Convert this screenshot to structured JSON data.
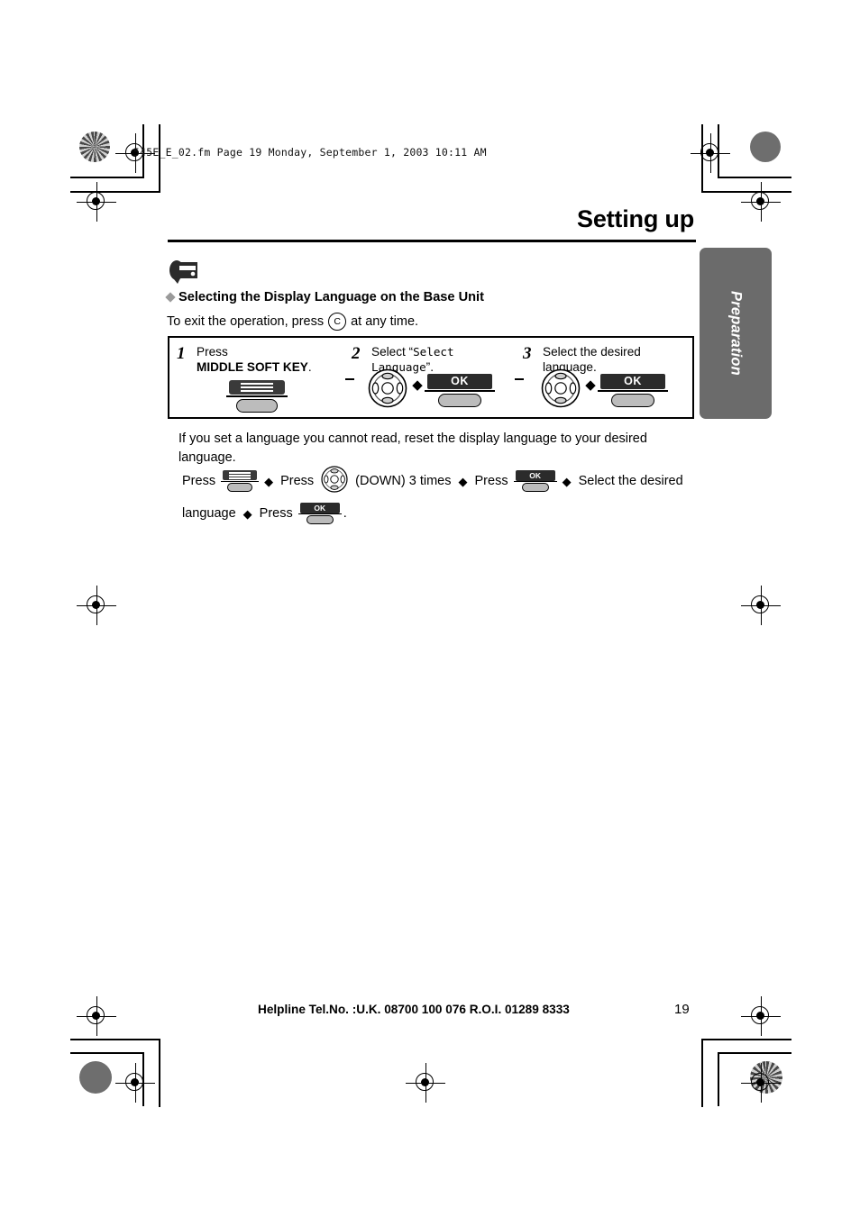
{
  "header": {
    "filename_line": "545E_E_02.fm  Page 19  Monday, September 1, 2003  10:11 AM"
  },
  "page": {
    "title": "Setting up",
    "side_tab": "Preparation",
    "page_number": "19"
  },
  "section": {
    "heading": "Selecting the Display Language on the Base Unit",
    "exit_prefix": "To exit the operation, press",
    "exit_key": "C",
    "exit_suffix": "at any time."
  },
  "steps": [
    {
      "number": "1",
      "text_lead": "Press",
      "text_bold": "MIDDLE SOFT KEY",
      "text_tail": ".",
      "icons": [
        "soft-key"
      ]
    },
    {
      "number": "2",
      "text_lead": "Select “",
      "text_mono": "Select Language",
      "text_tail": "”.",
      "icons": [
        "navigator",
        "arrow",
        "ok-key"
      ],
      "ok_label": "OK"
    },
    {
      "number": "3",
      "text_lead": "Select the desired language.",
      "icons": [
        "navigator",
        "arrow",
        "ok-key"
      ],
      "ok_label": "OK"
    }
  ],
  "note": {
    "paragraph": "If you set a language you cannot read, reset the display language to your desired language.",
    "flow_row1": [
      {
        "type": "text",
        "value": "Press"
      },
      {
        "type": "icon",
        "value": "soft-key"
      },
      {
        "type": "arrow",
        "value": "◆"
      },
      {
        "type": "text",
        "value": "Press"
      },
      {
        "type": "icon",
        "value": "navigator"
      },
      {
        "type": "text",
        "value": "(DOWN) 3 times"
      },
      {
        "type": "arrow",
        "value": "◆"
      },
      {
        "type": "text",
        "value": "Press"
      },
      {
        "type": "icon",
        "value": "ok-key"
      },
      {
        "type": "arrow",
        "value": "◆"
      },
      {
        "type": "text",
        "value": "Select the desired"
      }
    ],
    "flow_row2": [
      {
        "type": "text",
        "value": "language"
      },
      {
        "type": "arrow",
        "value": "◆"
      },
      {
        "type": "text",
        "value": "Press"
      },
      {
        "type": "icon",
        "value": "ok-key"
      },
      {
        "type": "text",
        "value": "."
      }
    ],
    "labels": {
      "press": "Press",
      "down_3_times": "(DOWN) 3 times",
      "select_desired": "Select the desired",
      "language": "language",
      "period": ".",
      "ok": "OK",
      "arrow": "◆"
    }
  },
  "footer": {
    "helpline": "Helpline Tel.No. :U.K. 08700 100 076  R.O.I. 01289 8333"
  },
  "colors": {
    "side_tab_bg": "#6b6b6b",
    "key_cap_dark": "#2b2b2b",
    "key_pill_grey": "#bcbcbc",
    "diamond_grey": "#9a9a9a"
  }
}
